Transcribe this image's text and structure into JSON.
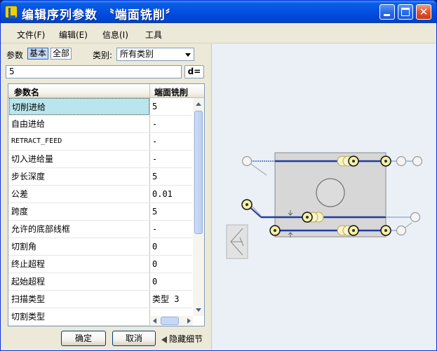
{
  "window": {
    "title": "编辑序列参数 〝端面铣削〞"
  },
  "menu": {
    "items": [
      "文件(F)",
      "编辑(E)",
      "信息(I)",
      "工具"
    ]
  },
  "params_bar": {
    "label": "参数",
    "basic_label": "基本",
    "all_label": "全部",
    "category_label": "类别:",
    "category_value": "所有类别"
  },
  "search": {
    "value": "5",
    "button_label": "d="
  },
  "table": {
    "headers": [
      "参数名",
      "端面铣削"
    ],
    "rows": [
      {
        "name": "切削进给",
        "value": "5"
      },
      {
        "name": "自由进给",
        "value": "-"
      },
      {
        "name": "RETRACT_FEED",
        "value": "-"
      },
      {
        "name": "切入进给量",
        "value": "-"
      },
      {
        "name": "步长深度",
        "value": "5"
      },
      {
        "name": "公差",
        "value": "0.01"
      },
      {
        "name": "跨度",
        "value": "5"
      },
      {
        "name": "允许的底部线框",
        "value": "-"
      },
      {
        "name": "切割角",
        "value": "0"
      },
      {
        "name": "终止超程",
        "value": "0"
      },
      {
        "name": "起始超程",
        "value": "0"
      },
      {
        "name": "扫描类型",
        "value": "类型 3"
      },
      {
        "name": "切割类型",
        "value": ""
      }
    ],
    "selected_index": 0
  },
  "buttons": {
    "ok": "确定",
    "cancel": "取消",
    "hide_details": "隐藏细节"
  },
  "colors": {
    "titlebar": "#0553e6",
    "toolpath": "#1f3fa0",
    "marker_fill": "#f5f0a8",
    "selected_row": "#b8e6ec"
  },
  "icons": {
    "app": "app-icon",
    "minimize": "minimize-icon",
    "maximize": "maximize-icon",
    "close": "close-icon",
    "hide_arrow": "arrow-left-icon",
    "dropdown": "chevron-down-icon"
  }
}
